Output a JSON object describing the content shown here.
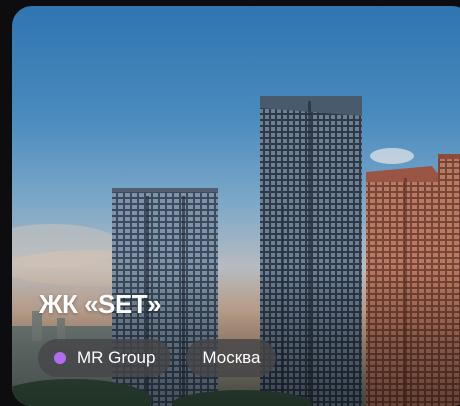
{
  "card": {
    "title": "ЖК «SET»",
    "tags": [
      {
        "label": "MR Group",
        "dot_color": "#b36bf2"
      },
      {
        "label": "Москва"
      }
    ]
  }
}
